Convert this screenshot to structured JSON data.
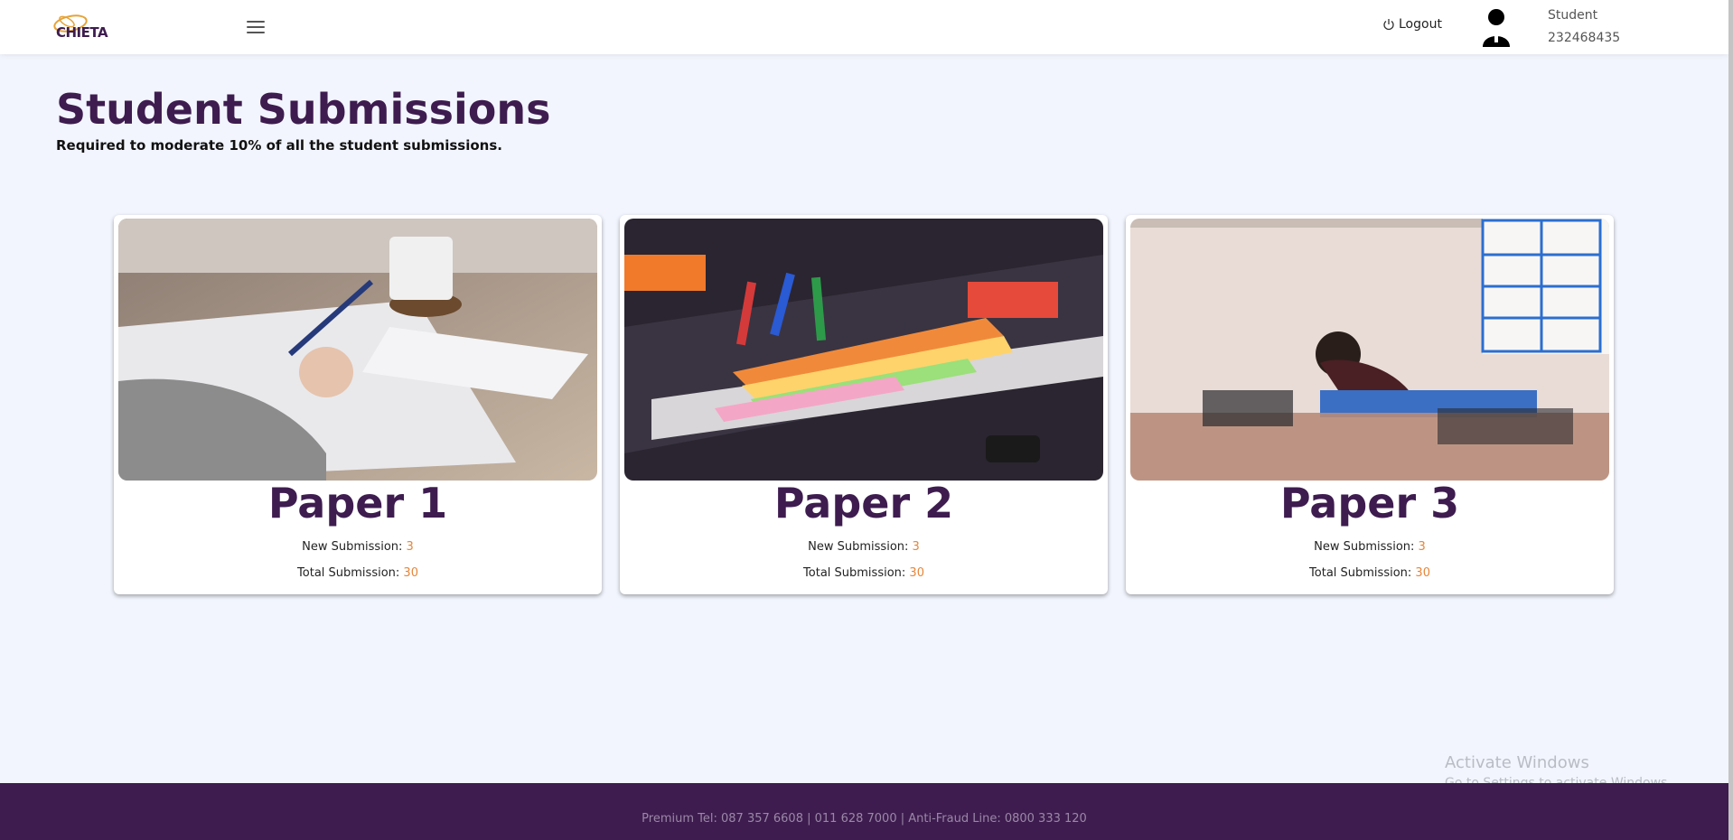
{
  "header": {
    "logo_text": "CHIETA",
    "logout_label": "Logout",
    "user_role": "Student",
    "user_id": "232468435"
  },
  "page": {
    "title": "Student Submissions",
    "subtitle": "Required to moderate 10% of all the student submissions."
  },
  "cards": [
    {
      "title": "Paper 1",
      "new_label": "New Submission:",
      "new_count": "3",
      "total_label": "Total Submission:",
      "total_count": "30"
    },
    {
      "title": "Paper 2",
      "new_label": "New Submission:",
      "new_count": "3",
      "total_label": "Total Submission:",
      "total_count": "30"
    },
    {
      "title": "Paper 3",
      "new_label": "New Submission:",
      "new_count": "3",
      "total_label": "Total Submission:",
      "total_count": "30"
    }
  ],
  "watermark": {
    "line1": "Activate Windows",
    "line2": "Go to Settings to activate Windows."
  },
  "footer": {
    "text": "Premium Tel: 087 357 6608 | 011 628 7000 | Anti-Fraud Line: 0800 333 120"
  },
  "colors": {
    "brand": "#3e1c4f",
    "accent": "#e5863a",
    "background": "#f2f5fd"
  }
}
